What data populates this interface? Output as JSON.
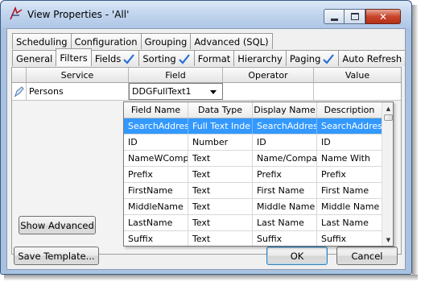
{
  "window": {
    "title": "View Properties - 'All'",
    "min_icon": "minimize-icon",
    "max_icon": "maximize-icon",
    "close_icon": "close-icon",
    "close_glyph": "✕"
  },
  "tabs_top": [
    {
      "label": "Scheduling"
    },
    {
      "label": "Configuration"
    },
    {
      "label": "Grouping"
    },
    {
      "label": "Advanced (SQL)"
    }
  ],
  "tabs_bottom": [
    {
      "label": "General"
    },
    {
      "label": "Filters",
      "active": true
    },
    {
      "label": "Fields",
      "checked": true
    },
    {
      "label": "Sorting",
      "checked": true
    },
    {
      "label": "Format"
    },
    {
      "label": "Hierarchy"
    },
    {
      "label": "Paging",
      "checked": true
    },
    {
      "label": "Auto Refresh"
    }
  ],
  "grid": {
    "headers": [
      "Service",
      "Field",
      "Operator",
      "Value"
    ],
    "row": {
      "service": "Persons",
      "field": "DDGFullText1",
      "operator": "",
      "value": ""
    }
  },
  "field_dropdown": {
    "headers": [
      "Field Name",
      "Data Type",
      "Display Name",
      "Description"
    ],
    "rows": [
      [
        "SearchAddres",
        "Full Text Inde",
        "SearchAddres",
        "SearchAddres"
      ],
      [
        "ID",
        "Number",
        "ID",
        "ID"
      ],
      [
        "NameWComp",
        "Text",
        "Name/Compa",
        "Name With"
      ],
      [
        "Prefix",
        "Text",
        "Prefix",
        "Prefix"
      ],
      [
        "FirstName",
        "Text",
        "First Name",
        "First Name"
      ],
      [
        "MiddleName",
        "Text",
        "Middle Name",
        "Middle Name"
      ],
      [
        "LastName",
        "Text",
        "Last Name",
        "Last Name"
      ],
      [
        "Suffix",
        "Text",
        "Suffix",
        "Suffix"
      ]
    ],
    "selected_index": 0
  },
  "buttons": {
    "show_advanced": "Show Advanced",
    "save_template": "Save Template...",
    "ok": "OK",
    "cancel": "Cancel"
  },
  "colors": {
    "selection": "#3399ff",
    "title_bar": "#c3d6ee",
    "close_button": "#c8452c",
    "checkmark": "#2a6fd6"
  }
}
